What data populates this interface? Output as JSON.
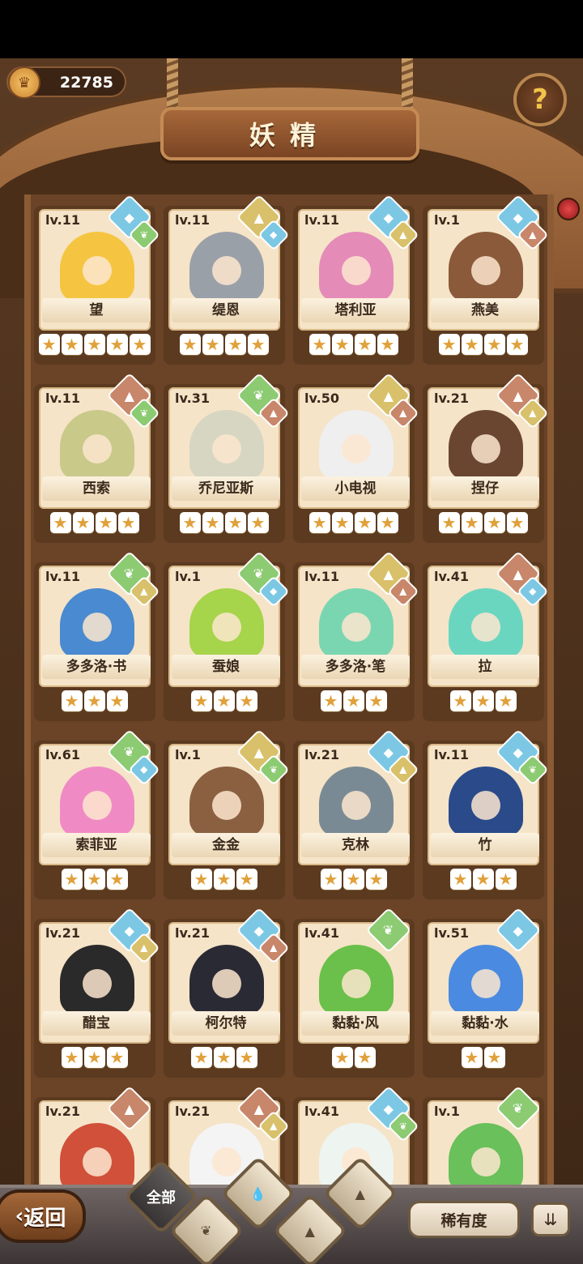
{
  "currency": {
    "value": "22785",
    "icon": "coin-icon"
  },
  "title": "妖精",
  "help": {
    "icon": "question-icon",
    "glyph": "?"
  },
  "fairies": [
    {
      "level": "lv.11",
      "name": "望",
      "stars": 5,
      "elements": [
        "water",
        "leaf"
      ],
      "color": "#f5c542"
    },
    {
      "level": "lv.11",
      "name": "缇恩",
      "stars": 4,
      "elements": [
        "earth",
        "water"
      ],
      "color": "#9aa0a8"
    },
    {
      "level": "lv.11",
      "name": "塔利亚",
      "stars": 4,
      "elements": [
        "water",
        "earth"
      ],
      "color": "#e58bb8"
    },
    {
      "level": "lv.1",
      "name": "燕美",
      "stars": 4,
      "elements": [
        "water",
        "fire"
      ],
      "color": "#8a5a3a"
    },
    {
      "level": "lv.11",
      "name": "西索",
      "stars": 4,
      "elements": [
        "fire",
        "leaf"
      ],
      "color": "#c9c98a"
    },
    {
      "level": "lv.31",
      "name": "乔尼亚斯",
      "stars": 4,
      "elements": [
        "leaf",
        "fire"
      ],
      "color": "#d6d6c2"
    },
    {
      "level": "lv.50",
      "name": "小电视",
      "stars": 4,
      "elements": [
        "earth",
        "fire"
      ],
      "color": "#efefef"
    },
    {
      "level": "lv.21",
      "name": "捏仔",
      "stars": 4,
      "elements": [
        "fire",
        "earth"
      ],
      "color": "#6a4630"
    },
    {
      "level": "lv.11",
      "name": "多多洛·书",
      "stars": 3,
      "elements": [
        "leaf",
        "earth"
      ],
      "color": "#4a8ad0"
    },
    {
      "level": "lv.1",
      "name": "蚕娘",
      "stars": 3,
      "elements": [
        "leaf",
        "water"
      ],
      "color": "#a6d44a"
    },
    {
      "level": "lv.11",
      "name": "多多洛·笔",
      "stars": 3,
      "elements": [
        "earth",
        "fire"
      ],
      "color": "#7ad6b0"
    },
    {
      "level": "lv.41",
      "name": "拉",
      "stars": 3,
      "elements": [
        "fire",
        "water"
      ],
      "color": "#6ad6c0"
    },
    {
      "level": "lv.61",
      "name": "索菲亚",
      "stars": 3,
      "elements": [
        "leaf",
        "water"
      ],
      "color": "#f08ac4"
    },
    {
      "level": "lv.1",
      "name": "金金",
      "stars": 3,
      "elements": [
        "earth",
        "leaf"
      ],
      "color": "#8a6040"
    },
    {
      "level": "lv.21",
      "name": "克林",
      "stars": 3,
      "elements": [
        "water",
        "earth"
      ],
      "color": "#7a8a94"
    },
    {
      "level": "lv.11",
      "name": "竹",
      "stars": 3,
      "elements": [
        "water",
        "leaf"
      ],
      "color": "#2a4a8a"
    },
    {
      "level": "lv.21",
      "name": "醋宝",
      "stars": 3,
      "elements": [
        "water",
        "earth"
      ],
      "color": "#2a2a2a"
    },
    {
      "level": "lv.21",
      "name": "柯尔特",
      "stars": 3,
      "elements": [
        "water",
        "fire"
      ],
      "color": "#2a2a34"
    },
    {
      "level": "lv.41",
      "name": "黏黏·风",
      "stars": 2,
      "elements": [
        "leaf"
      ],
      "color": "#6ac04a"
    },
    {
      "level": "lv.51",
      "name": "黏黏·水",
      "stars": 2,
      "elements": [
        "water"
      ],
      "color": "#4a8ae0"
    },
    {
      "level": "lv.21",
      "name": "",
      "stars": 0,
      "elements": [
        "fire"
      ],
      "color": "#d0503a"
    },
    {
      "level": "lv.21",
      "name": "",
      "stars": 0,
      "elements": [
        "fire",
        "earth"
      ],
      "color": "#f4f4f4"
    },
    {
      "level": "lv.41",
      "name": "",
      "stars": 0,
      "elements": [
        "water",
        "leaf"
      ],
      "color": "#eef4f0"
    },
    {
      "level": "lv.1",
      "name": "",
      "stars": 0,
      "elements": [
        "leaf"
      ],
      "color": "#6ac05a"
    }
  ],
  "bottom": {
    "back_label": "返回",
    "filter_all_label": "全部",
    "sort_label": "稀有度",
    "order_icon": "sort-order-icon"
  }
}
